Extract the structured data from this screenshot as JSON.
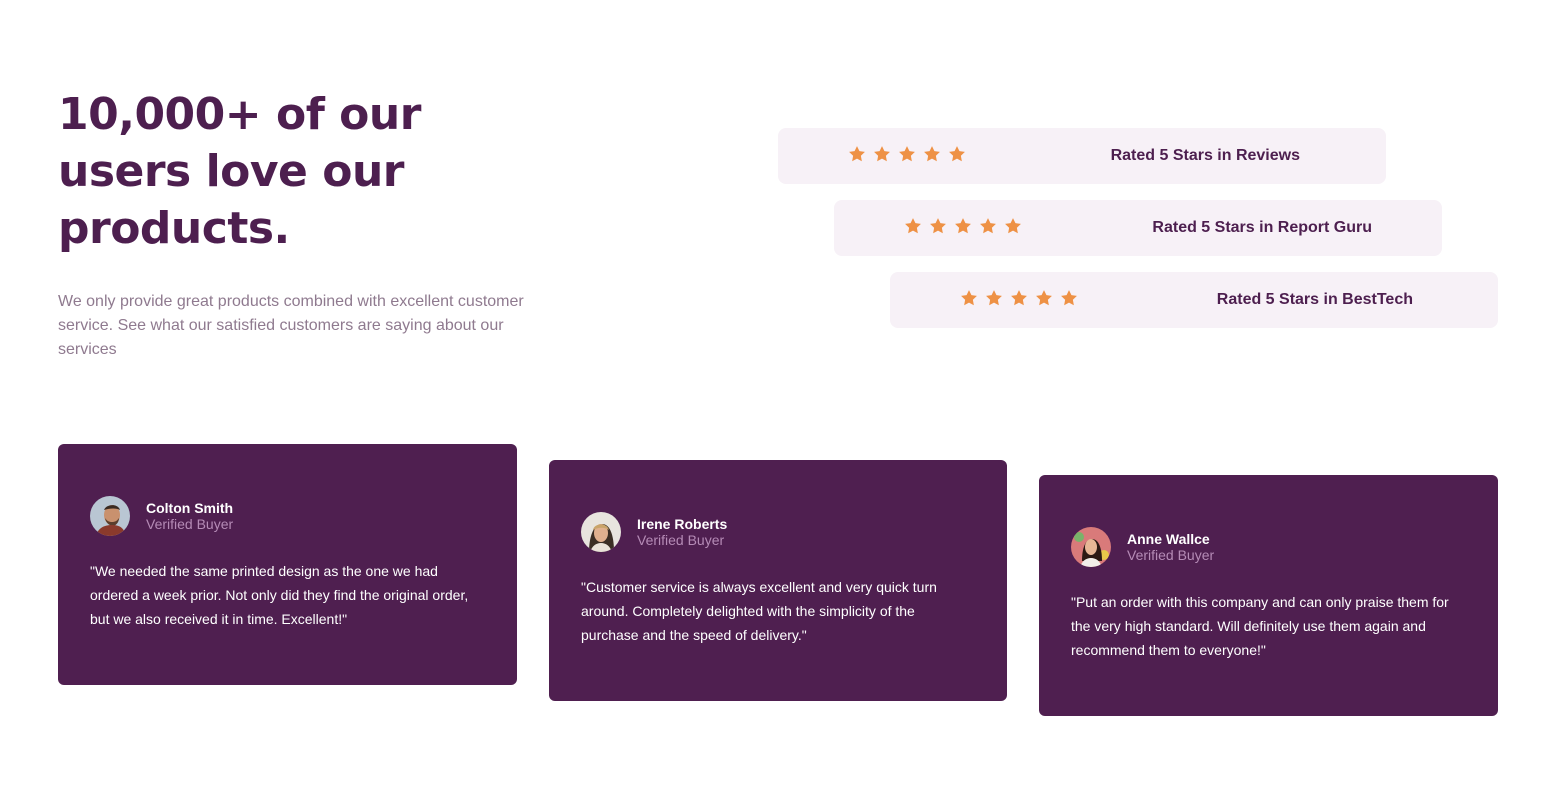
{
  "hero": {
    "headline": "10,000+ of our users love our products.",
    "intro": "We only provide great products combined with excellent customer service. See what our satisfied customers are saying about our services"
  },
  "ratings": [
    {
      "stars": 5,
      "label": "Rated 5 Stars in Reviews"
    },
    {
      "stars": 5,
      "label": "Rated 5 Stars in Report Guru"
    },
    {
      "stars": 5,
      "label": "Rated 5 Stars in BestTech"
    }
  ],
  "testimonials": [
    {
      "name": "Colton Smith",
      "role": "Verified Buyer",
      "quote": "\"We needed the same printed design as the one we had ordered a week prior. Not only did they find the original order, but we also received it in time. Excellent!\""
    },
    {
      "name": "Irene Roberts",
      "role": "Verified Buyer",
      "quote": "\"Customer service is always excellent and very quick turn around. Completely delighted with the simplicity of the purchase and the speed of delivery.\""
    },
    {
      "name": "Anne Wallce",
      "role": "Verified Buyer",
      "quote": "\"Put an order with this company and can only praise them for the very high standard. Will definitely use them again and recommend them to everyone!\""
    }
  ],
  "colors": {
    "primary": "#4d1f4f",
    "card_bg": "#4f1f50",
    "rating_bg": "#f7f1f7",
    "star": "#ee9145",
    "muted_text": "#8f7a8f",
    "card_muted": "#b58bb6"
  },
  "icons": {
    "star": "star-icon"
  }
}
